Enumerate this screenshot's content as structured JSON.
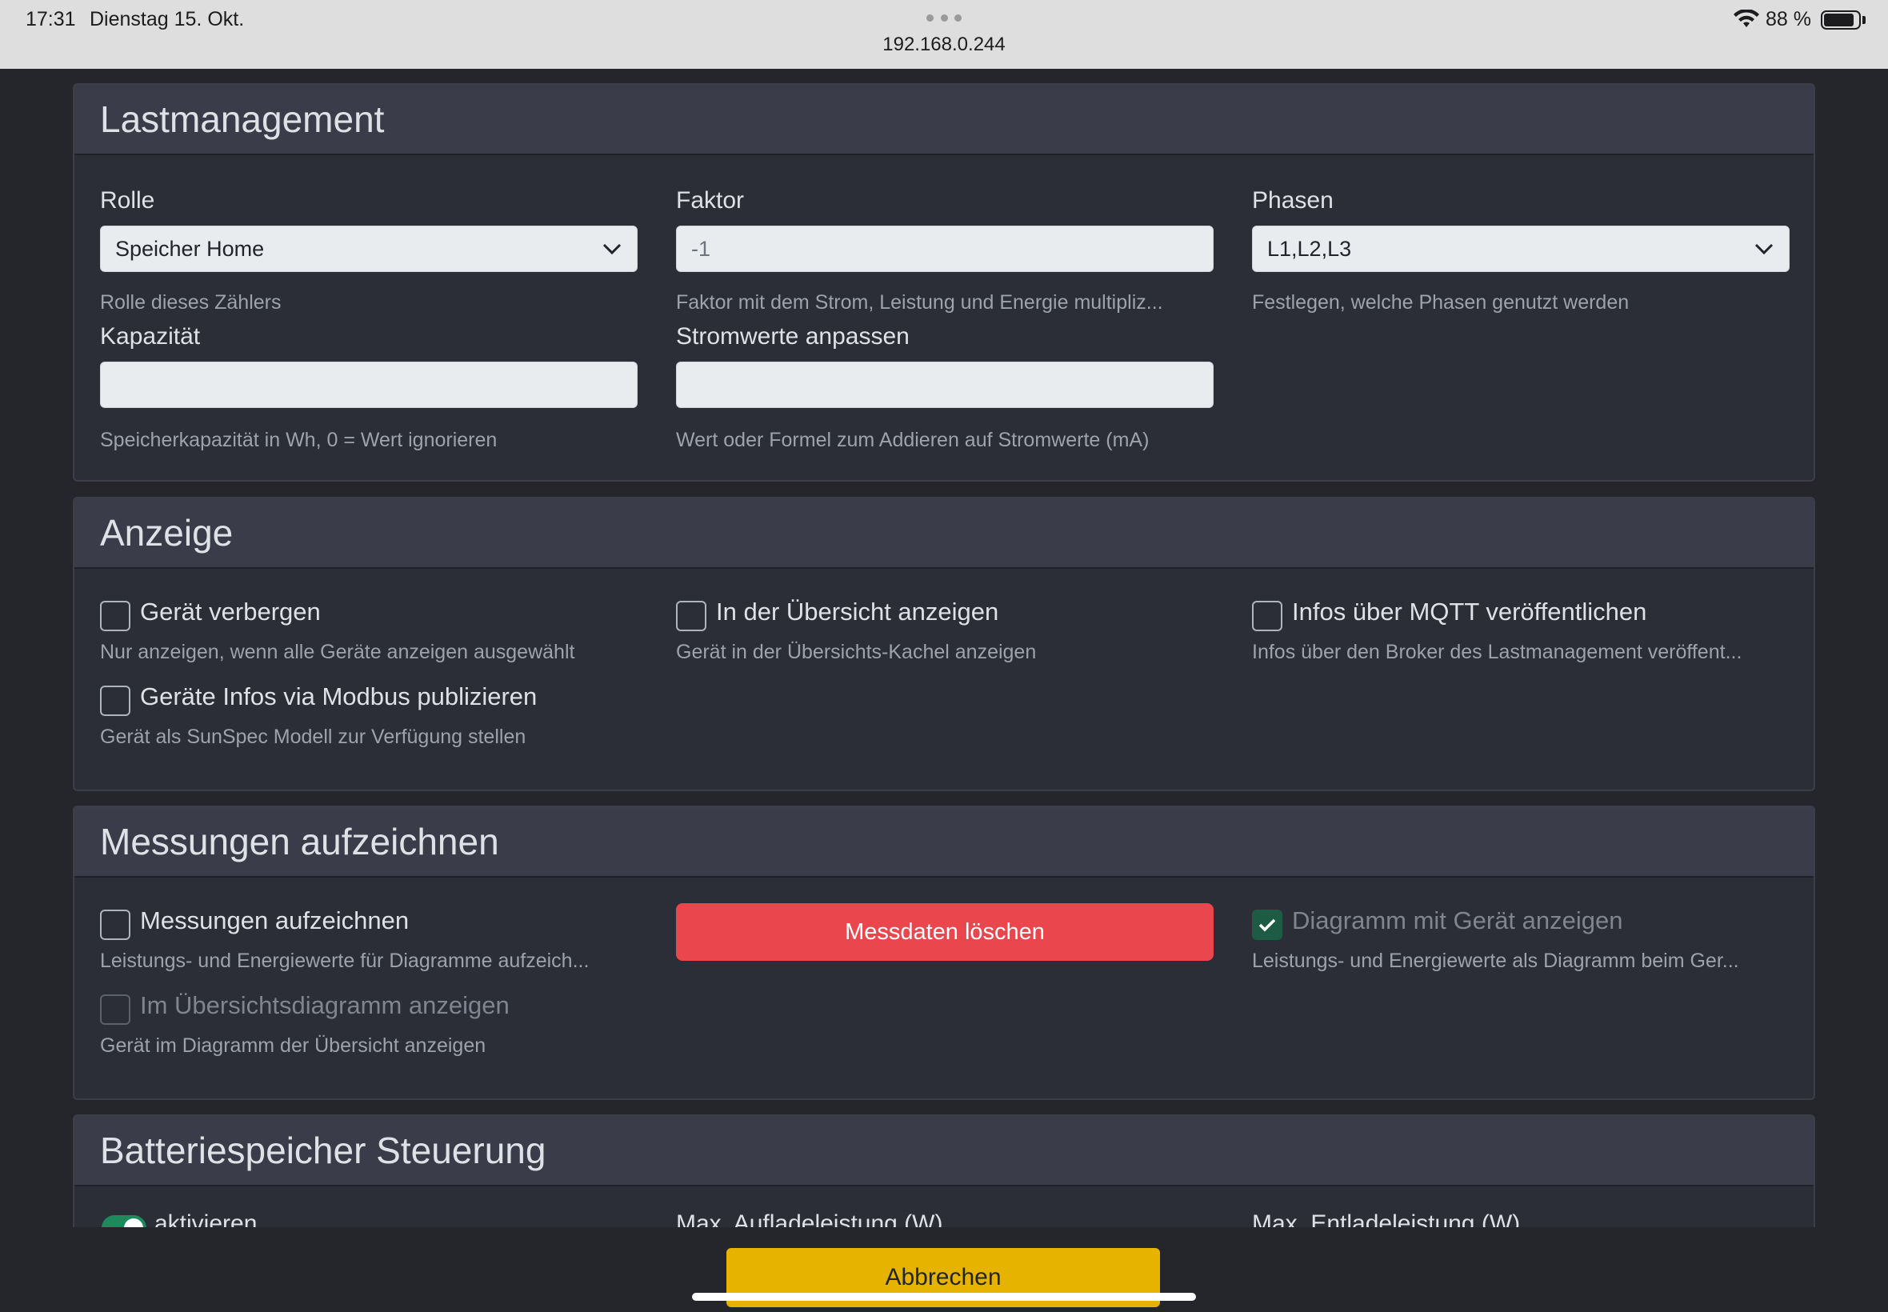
{
  "statusbar": {
    "time": "17:31",
    "date": "Dienstag 15. Okt.",
    "url": "192.168.0.244",
    "battery_pct": "88 %",
    "battery_level": 0.88
  },
  "lastmanagement": {
    "title": "Lastmanagement",
    "rolle": {
      "label": "Rolle",
      "value": "Speicher Home",
      "help": "Rolle dieses Zählers"
    },
    "faktor": {
      "label": "Faktor",
      "value": "-1",
      "help": "Faktor mit dem Strom, Leistung und Energie multipliz..."
    },
    "phasen": {
      "label": "Phasen",
      "value": "L1,L2,L3",
      "help": "Festlegen, welche Phasen genutzt werden"
    },
    "kapazitaet": {
      "label": "Kapazität",
      "value": "",
      "help": "Speicherkapazität in Wh, 0 = Wert ignorieren"
    },
    "stromwerte": {
      "label": "Stromwerte anpassen",
      "value": "",
      "help": "Wert oder Formel zum Addieren auf Stromwerte (mA)"
    }
  },
  "anzeige": {
    "title": "Anzeige",
    "geraet_verbergen": {
      "label": "Gerät verbergen",
      "help": "Nur anzeigen, wenn alle Geräte anzeigen ausgewählt",
      "checked": false
    },
    "uebersicht": {
      "label": "In der Übersicht anzeigen",
      "help": "Gerät in der Übersichts-Kachel anzeigen",
      "checked": false
    },
    "mqtt": {
      "label": "Infos über MQTT veröffentlichen",
      "help": "Infos über den Broker des Lastmanagement veröffent...",
      "checked": false
    },
    "modbus": {
      "label": "Geräte Infos via Modbus publizieren",
      "help": "Gerät als SunSpec Modell zur Verfügung stellen",
      "checked": false
    }
  },
  "messungen": {
    "title": "Messungen aufzeichnen",
    "aufzeichnen": {
      "label": "Messungen aufzeichnen",
      "help": "Leistungs- und Energiewerte für Diagramme aufzeich...",
      "checked": false
    },
    "loeschen_button": "Messdaten löschen",
    "diagramm": {
      "label": "Diagramm mit Gerät anzeigen",
      "help": "Leistungs- und Energiewerte als Diagramm beim Ger...",
      "checked": true
    },
    "uebersichtsdiagramm": {
      "label": "Im Übersichtsdiagramm anzeigen",
      "help": "Gerät im Diagramm der Übersicht anzeigen",
      "checked": false
    }
  },
  "batterie": {
    "title": "Batteriespeicher Steuerung",
    "aktivieren": "aktivieren",
    "max_aufladeleistung": "Max. Aufladeleistung (W)",
    "max_entladeleistung": "Max. Entladeleistung (W)"
  },
  "footer": {
    "cancel_button": "Abbrechen"
  },
  "colors": {
    "danger": "#e9464d",
    "warning": "#e6b400",
    "success": "#1e5b45"
  }
}
